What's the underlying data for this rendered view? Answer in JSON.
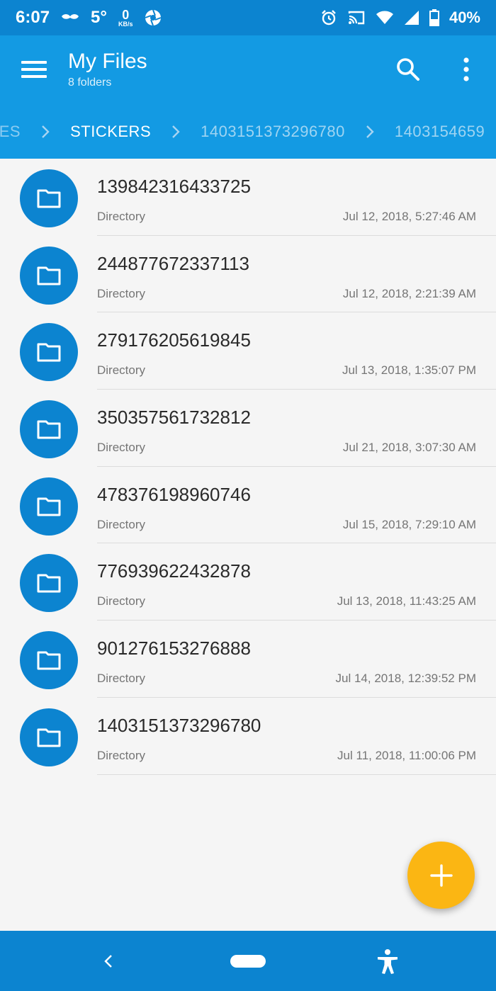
{
  "status_bar": {
    "time": "6:07",
    "temperature": "5°",
    "speed_value": "0",
    "speed_unit": "KB/s",
    "battery": "40%",
    "icons": [
      "mustache-icon",
      "aperture-icon",
      "alarm-icon",
      "cast-icon",
      "wifi-icon",
      "signal-icon",
      "battery-icon"
    ]
  },
  "app_bar": {
    "title": "My Files",
    "subtitle": "8 folders"
  },
  "breadcrumb": {
    "items": [
      "LES",
      "STICKERS",
      "1403151373296780",
      "1403154659"
    ],
    "active_index": 1
  },
  "files": [
    {
      "name": "139842316433725",
      "type": "Directory",
      "date": "Jul 12, 2018, 5:27:46 AM"
    },
    {
      "name": "244877672337113",
      "type": "Directory",
      "date": "Jul 12, 2018, 2:21:39 AM"
    },
    {
      "name": "279176205619845",
      "type": "Directory",
      "date": "Jul 13, 2018, 1:35:07 PM"
    },
    {
      "name": "350357561732812",
      "type": "Directory",
      "date": "Jul 21, 2018, 3:07:30 AM"
    },
    {
      "name": "478376198960746",
      "type": "Directory",
      "date": "Jul 15, 2018, 7:29:10 AM"
    },
    {
      "name": "776939622432878",
      "type": "Directory",
      "date": "Jul 13, 2018, 11:43:25 AM"
    },
    {
      "name": "901276153276888",
      "type": "Directory",
      "date": "Jul 14, 2018, 12:39:52 PM"
    },
    {
      "name": "1403151373296780",
      "type": "Directory",
      "date": "Jul 11, 2018, 11:00:06 PM"
    }
  ],
  "colors": {
    "status_bar": "#0c84d0",
    "app_bar": "#139ae3",
    "folder_avatar": "#0c84d0",
    "fab": "#fbb613",
    "background": "#f5f5f5"
  }
}
